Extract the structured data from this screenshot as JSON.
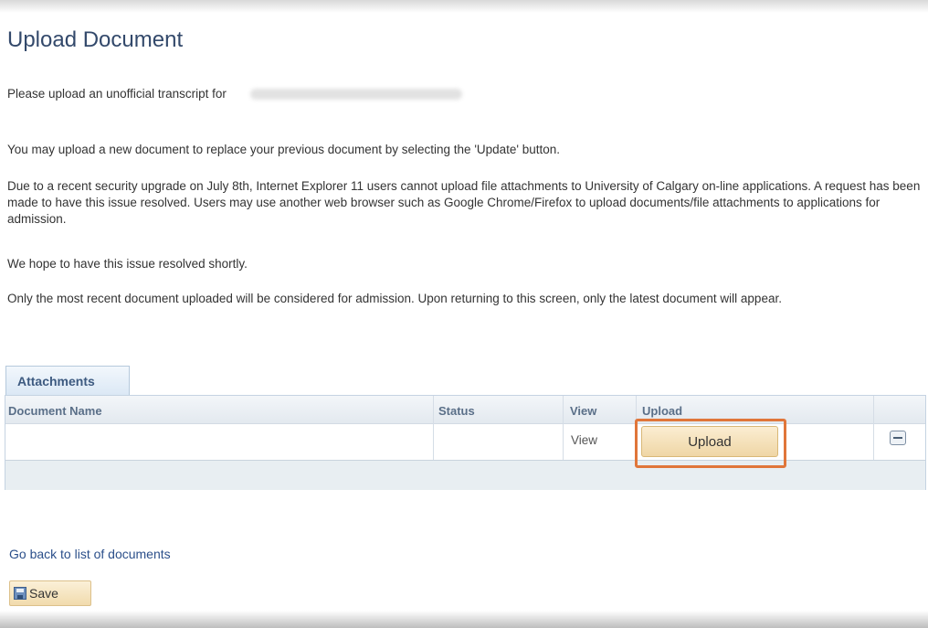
{
  "page": {
    "title": "Upload Document"
  },
  "instructions": {
    "transcript_prompt": "Please upload an unofficial transcript for",
    "replace_note": "You may upload a new document to replace your previous document by selecting the 'Update' button.",
    "security_note": "Due to a recent security upgrade on July 8th, Internet Explorer 11 users cannot upload file attachments to University of Calgary on-line applications. A request has been made to have this issue resolved. Users may use another web browser such as Google Chrome/Firefox to upload documents/file attachments to applications for admission.",
    "hope_note": "We hope to have this issue resolved shortly.",
    "recent_note": "Only the most recent document uploaded will be considered for admission. Upon returning to this screen, only the latest document will appear."
  },
  "attachments": {
    "tab_label": "Attachments",
    "columns": {
      "document_name": "Document Name",
      "status": "Status",
      "view": "View",
      "upload": "Upload"
    },
    "rows": [
      {
        "document_name": "",
        "status": "",
        "view": "View",
        "upload_button": "Upload",
        "delete_icon": "minus-icon"
      }
    ]
  },
  "footer": {
    "back_link": "Go back to list of documents",
    "save_label": "Save",
    "save_icon": "save-icon"
  },
  "colors": {
    "title": "#33496b",
    "link": "#2b4f8a",
    "highlight": "#e0763a",
    "button_bg": "#f1dbad"
  }
}
